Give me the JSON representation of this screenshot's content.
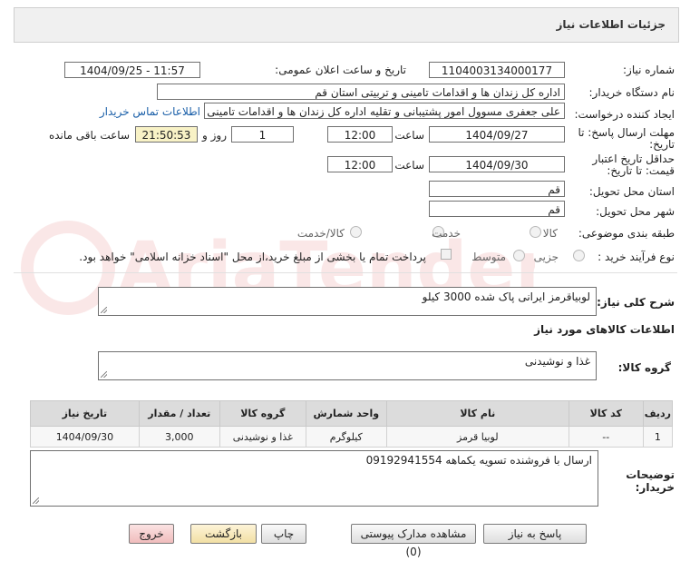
{
  "header": {
    "title": "جزئیات اطلاعات نیاز"
  },
  "fields": {
    "need_number_label": "شماره نیاز:",
    "need_number": "1104003134000177",
    "announce_label": "تاریخ و ساعت اعلان عمومی:",
    "announce_value": "1404/09/25 - 11:57",
    "buyer_org_label": "نام دستگاه خریدار:",
    "buyer_org": "اداره کل زندان ها و اقدامات تامینی و تربیتی استان قم",
    "requester_label": "ایجاد کننده درخواست:",
    "requester": "علی جعفری مسوول امور پشتیبانی و تقلیه اداره کل زندان ها و اقدامات تامینی و",
    "contact_link": "اطلاعات تماس خریدار",
    "deadline_label_1": "مهلت ارسال پاسخ: تا",
    "deadline_label_2": "تاریخ:",
    "deadline_date": "1404/09/27",
    "time_label": "ساعت",
    "deadline_time": "12:00",
    "days_value": "1",
    "days_label": "روز و",
    "remaining_time": "21:50:53",
    "remaining_label": "ساعت باقی مانده",
    "validity_label_1": "حداقل تاریخ اعتبار",
    "validity_label_2": "قیمت: تا تاریخ:",
    "validity_date": "1404/09/30",
    "validity_time": "12:00",
    "province_label": "استان محل تحویل:",
    "province": "قم",
    "city_label": "شهر محل تحویل:",
    "city": "قم",
    "category_label": "طبقه بندی موضوعی:",
    "category_options": [
      "کالا",
      "خدمت",
      "کالا/خدمت"
    ],
    "process_label": "نوع فرآیند خرید :",
    "process_options": [
      "جزیی",
      "متوسط"
    ],
    "payment_note": "پرداخت تمام یا بخشی از مبلغ خرید،از محل \"اسناد خزانه اسلامی\" خواهد بود."
  },
  "description": {
    "label": "شرح کلی نیاز:",
    "value": "لوبیاقرمز ایرانی پاک شده 3000 کیلو"
  },
  "goods_info": {
    "title": "اطلاعات کالاهای مورد نیاز",
    "group_label": "گروه کالا:",
    "group_value": "غذا و نوشیدنی"
  },
  "table": {
    "headers": [
      "ردیف",
      "کد کالا",
      "نام کالا",
      "واحد شمارش",
      "گروه کالا",
      "تعداد / مقدار",
      "تاریخ نیاز"
    ],
    "rows": [
      [
        "1",
        "--",
        "لوبیا قرمز",
        "کیلوگرم",
        "غذا و نوشیدنی",
        "3,000",
        "1404/09/30"
      ]
    ]
  },
  "buyer_notes": {
    "label_1": "توضیحات",
    "label_2": "خریدار:",
    "value": "ارسال با فروشنده تسویه یکماهه 09192941554"
  },
  "buttons": {
    "reply": "پاسخ به نیاز",
    "attachments": "مشاهده مدارک پیوستی (0)",
    "print": "چاپ",
    "back": "بازگشت",
    "exit": "خروج"
  },
  "colors": {
    "link": "#1a5fa8",
    "highlight": "#f8f2c6",
    "exit": "#f0bcbc",
    "back": "#f2e0a4"
  }
}
